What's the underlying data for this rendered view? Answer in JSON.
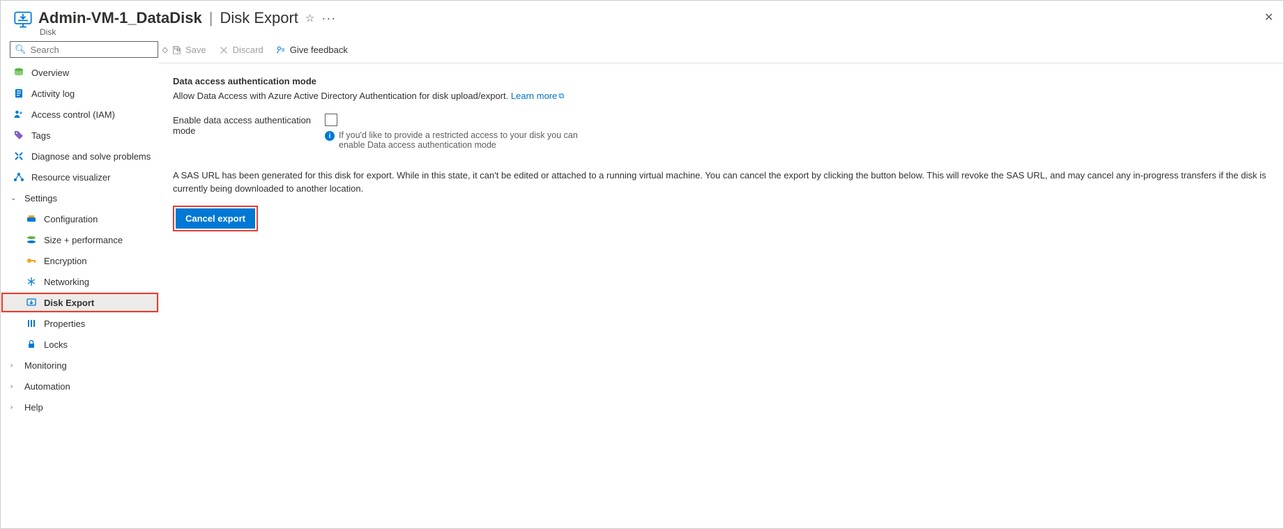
{
  "header": {
    "title": "Admin-VM-1_DataDisk",
    "resourceType": "Disk",
    "section": "Disk Export"
  },
  "search": {
    "placeholder": "Search"
  },
  "toolbar": {
    "save": "Save",
    "discard": "Discard",
    "feedback": "Give feedback"
  },
  "nav": {
    "overview": "Overview",
    "activity": "Activity log",
    "iam": "Access control (IAM)",
    "tags": "Tags",
    "diag": "Diagnose and solve problems",
    "resviz": "Resource visualizer",
    "settings": "Settings",
    "config": "Configuration",
    "size": "Size + performance",
    "enc": "Encryption",
    "net": "Networking",
    "export": "Disk Export",
    "props": "Properties",
    "locks": "Locks",
    "monitoring": "Monitoring",
    "automation": "Automation",
    "help": "Help"
  },
  "content": {
    "heading": "Data access authentication mode",
    "desc": "Allow Data Access with Azure Active Directory Authentication for disk upload/export.",
    "learnMore": "Learn more",
    "fieldLabel": "Enable data access authentication mode",
    "infoText": "If you'd like to provide a restricted access to your disk you can enable Data access authentication mode",
    "sasText": "A SAS URL has been generated for this disk for export. While in this state, it can't be edited or attached to a running virtual machine. You can cancel the export by clicking the button below. This will revoke the SAS URL, and may cancel any in-progress transfers if the disk is currently being downloaded to another location.",
    "cancelBtn": "Cancel export"
  }
}
